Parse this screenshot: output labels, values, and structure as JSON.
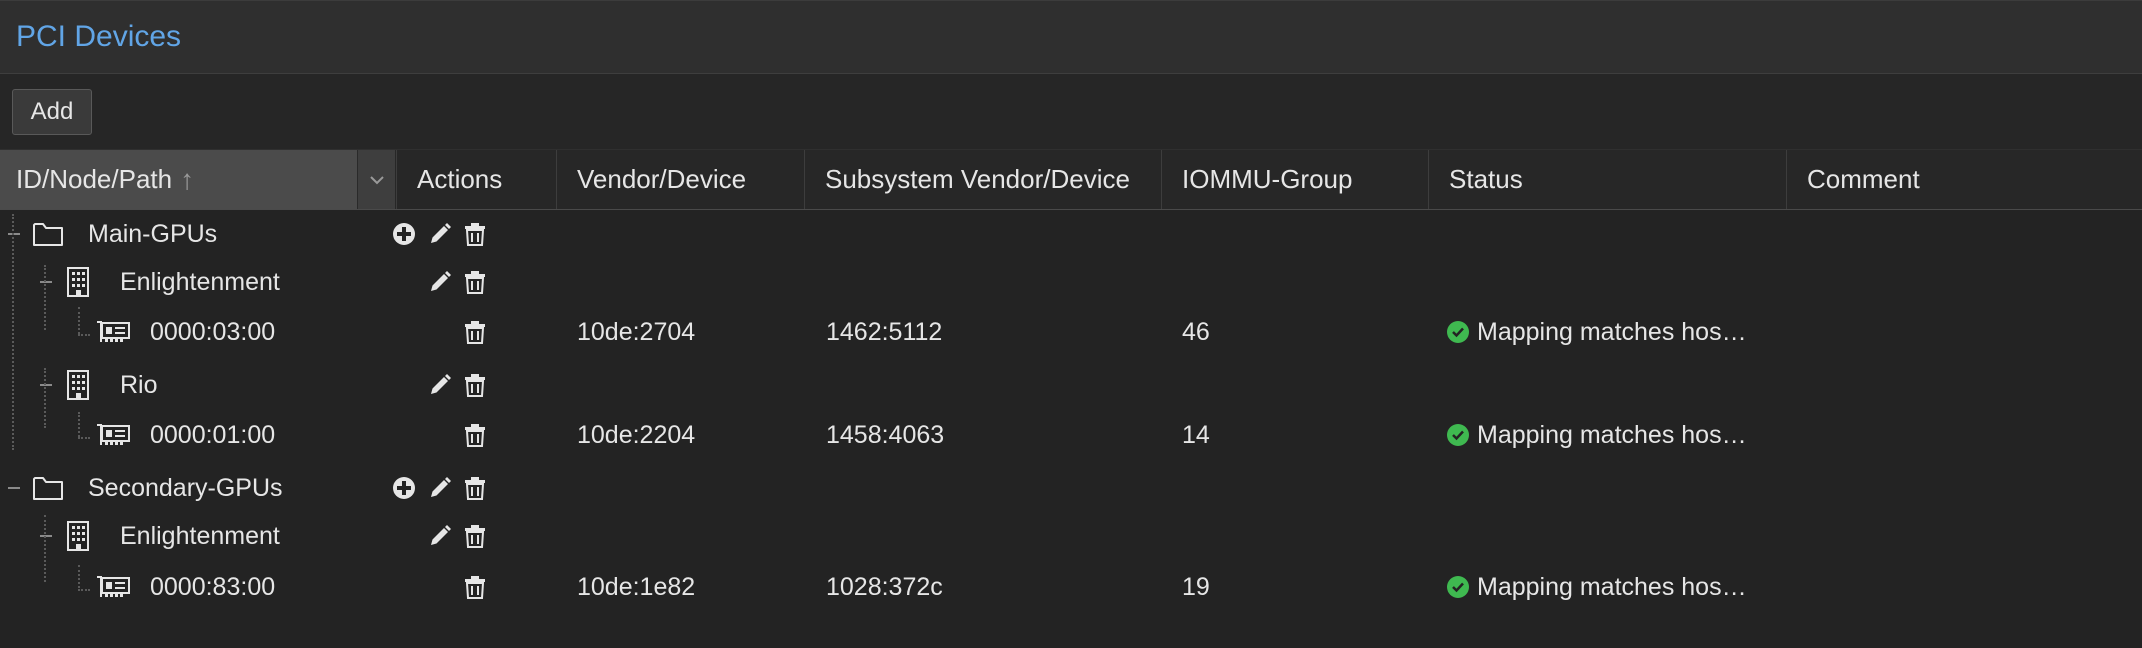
{
  "panel": {
    "title": "PCI Devices"
  },
  "toolbar": {
    "add_label": "Add"
  },
  "columns": {
    "id_path": "ID/Node/Path",
    "actions": "Actions",
    "vendor_device": "Vendor/Device",
    "subsystem": "Subsystem Vendor/Device",
    "iommu": "IOMMU-Group",
    "status": "Status",
    "comment": "Comment"
  },
  "rows": [
    {
      "label": "Main-GPUs",
      "type": "mapping",
      "actions": [
        "add",
        "edit",
        "delete"
      ]
    },
    {
      "label": "Enlightenment",
      "type": "node",
      "actions": [
        "edit",
        "delete"
      ]
    },
    {
      "label": "0000:03:00",
      "type": "device",
      "actions": [
        "delete"
      ],
      "vendor_device": "10de:2704",
      "subsystem": "1462:5112",
      "iommu": "46",
      "status": "Mapping matches hos…"
    },
    {
      "label": "Rio",
      "type": "node",
      "actions": [
        "edit",
        "delete"
      ]
    },
    {
      "label": "0000:01:00",
      "type": "device",
      "actions": [
        "delete"
      ],
      "vendor_device": "10de:2204",
      "subsystem": "1458:4063",
      "iommu": "14",
      "status": "Mapping matches hos…"
    },
    {
      "label": "Secondary-GPUs",
      "type": "mapping",
      "actions": [
        "add",
        "edit",
        "delete"
      ]
    },
    {
      "label": "Enlightenment",
      "type": "node",
      "actions": [
        "edit",
        "delete"
      ]
    },
    {
      "label": "0000:83:00",
      "type": "device",
      "actions": [
        "delete"
      ],
      "vendor_device": "10de:1e82",
      "subsystem": "1028:372c",
      "iommu": "19",
      "status": "Mapping matches hos…"
    }
  ],
  "colors": {
    "accent": "#61a5e6",
    "status_ok": "#3fb950",
    "background": "#232323"
  },
  "icons": {
    "mapping": "folder-icon",
    "node": "server-icon",
    "device": "pci-card-icon",
    "add": "plus-circle-icon",
    "edit": "pencil-icon",
    "delete": "trash-icon",
    "status": "check-circle-icon"
  }
}
